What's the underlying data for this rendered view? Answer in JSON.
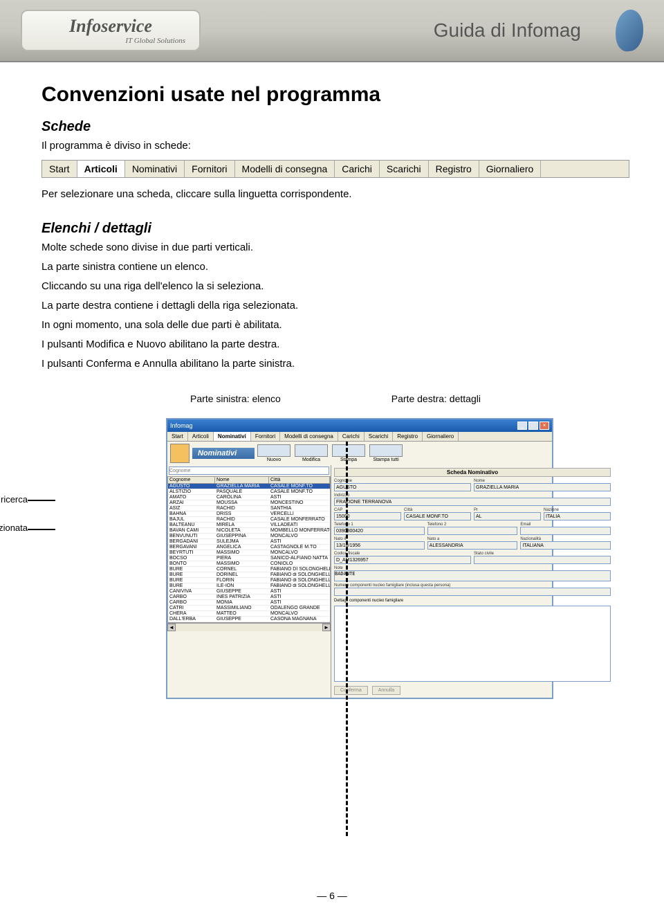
{
  "header": {
    "logo_main": "Infoservice",
    "logo_sub": "IT Global Solutions",
    "title": "Guida di Infomag"
  },
  "h1": "Convenzioni usate nel programma",
  "schede": {
    "heading": "Schede",
    "line1": "Il programma è diviso in schede:",
    "line2": "Per selezionare una scheda, cliccare sulla linguetta corrispondente.",
    "tabs": [
      "Start",
      "Articoli",
      "Nominativi",
      "Fornitori",
      "Modelli di consegna",
      "Carichi",
      "Scarichi",
      "Registro",
      "Giornaliero"
    ]
  },
  "elenchi": {
    "heading": "Elenchi / dettagli",
    "l1": "Molte schede sono divise in due parti verticali.",
    "l2": "La parte sinistra contiene un elenco.",
    "l3": "Cliccando su una riga dell'elenco la si seleziona.",
    "l4": "La parte destra contiene i dettagli della riga selezionata.",
    "l5": "In ogni momento, una sola delle due parti è abilitata.",
    "l6": "I pulsanti Modifica e Nuovo abilitano la parte destra.",
    "l7": "I pulsanti Conferma e Annulla abilitano la parte sinistra."
  },
  "annot": {
    "left": "Parte sinistra: elenco",
    "right": "Parte destra: dettagli",
    "campo": "Campo di ricerca",
    "riga": "Riga selezionata"
  },
  "app": {
    "title": "Infomag",
    "tabs": [
      "Start",
      "Articoli",
      "Nominativi",
      "Fornitori",
      "Modelli di consegna",
      "Carichi",
      "Scarichi",
      "Registro",
      "Giornaliero"
    ],
    "section": "Nominativi",
    "toolbar": [
      "Nuovo",
      "Modifica",
      "Stampa",
      "Stampa tutti"
    ],
    "search_placeholder": "Cognome",
    "cols": [
      "Cognome",
      "Nome",
      "Città"
    ],
    "rows": [
      [
        "AGUSTO",
        "GRAZIELLA MARIA",
        "CASALE MONF.TO"
      ],
      [
        "ALSTIZIO",
        "PASQUALE",
        "CASALE MONF.TO"
      ],
      [
        "AMATO",
        "CAROLINA",
        "ASTI"
      ],
      [
        "ARZAI",
        "MOUSSA",
        "MONCESTINO"
      ],
      [
        "ASIZ",
        "RACHID",
        "SANTHIA"
      ],
      [
        "BAHNA",
        "DRISS",
        "VERCELLI"
      ],
      [
        "BAJUL",
        "RACHID",
        "CASALE MONFERRATO"
      ],
      [
        "BALTEANU",
        "MIRELA",
        "VILLADEATI"
      ],
      [
        "BAVAN CAMI",
        "NICOLETA",
        "MOMBELLO MONFERRATO"
      ],
      [
        "BENVUNUTI",
        "GIUSEPPINA",
        "MONCALVO"
      ],
      [
        "BERGADANI",
        "SULEJMA",
        "ASTI"
      ],
      [
        "BERGAVANI",
        "ANGELICA",
        "CASTAGNOLE M.TO"
      ],
      [
        "BEYRTUTI",
        "MASSIMO",
        "MONCALVO"
      ],
      [
        "BOCSO",
        "PIERA",
        "SANICO-ALFIANO NATTA"
      ],
      [
        "BONTO",
        "MASSIMO",
        "CONIOLO"
      ],
      [
        "BURE",
        "CORNEL",
        "FABIANO DI SOLONGHELLO"
      ],
      [
        "BURE",
        "DORINEL",
        "FABIANO di SOLONGHELLO"
      ],
      [
        "BURE",
        "FLORIN",
        "FABIANO di SOLONGHELLO"
      ],
      [
        "BURE",
        "ILE-ION",
        "FABIANO di SOLONGHELLO"
      ],
      [
        "CANIVIVA",
        "GIUSEPPE",
        "ASTI"
      ],
      [
        "CARBO",
        "INES PATRIZIA",
        "ASTI"
      ],
      [
        "CARBO",
        "MONIA",
        "ASTI"
      ],
      [
        "CATRI",
        "MASSIMILIANO",
        "ODALENGO GRANDE"
      ],
      [
        "CHERA",
        "MATTEO",
        "MONCALVO"
      ],
      [
        "DALL'ERBA",
        "GIUSEPPE",
        "CASONA MAGNANA"
      ]
    ],
    "detail": {
      "title": "Scheda Nominativo",
      "cognome_l": "Cognome",
      "cognome": "AGUSTO",
      "nome_l": "Nome",
      "nome": "GRAZIELLA MARIA",
      "indirizzo_l": "Indirizzo",
      "indirizzo": "FRAZIONE TERRANOVA",
      "cap_l": "CAP",
      "cap": "15000",
      "citta_l": "Città",
      "citta": "CASALE MONF.TO",
      "pr_l": "Pr",
      "pr": "AL",
      "nazione_l": "Nazione",
      "nazione": "ITALIA",
      "tel1_l": "Telefono 1",
      "tel1": "0390300420",
      "tel2_l": "Telefono 2",
      "tel2": "",
      "email_l": "Email",
      "email": "",
      "natoil_l": "Nato il",
      "natoil": "13/10/1956",
      "natoa_l": "Nato a",
      "natoa": "ALESSANDRIA",
      "naz_l": "Nazionalità",
      "naz": "ITALIANA",
      "cf_l": "Codice fiscale",
      "cf": "D_AM1326957",
      "stato_l": "Stato civile",
      "stato": "",
      "note_l": "Note",
      "note": "BADANTE",
      "nucleo_l": "Numero componenti nucleo famigliare (inclusa questa persona)",
      "dettagli_l": "Dettagli componenti nucleo famigliare",
      "conferma": "Conferma",
      "annulla": "Annulla"
    }
  },
  "page": "— 6 —"
}
